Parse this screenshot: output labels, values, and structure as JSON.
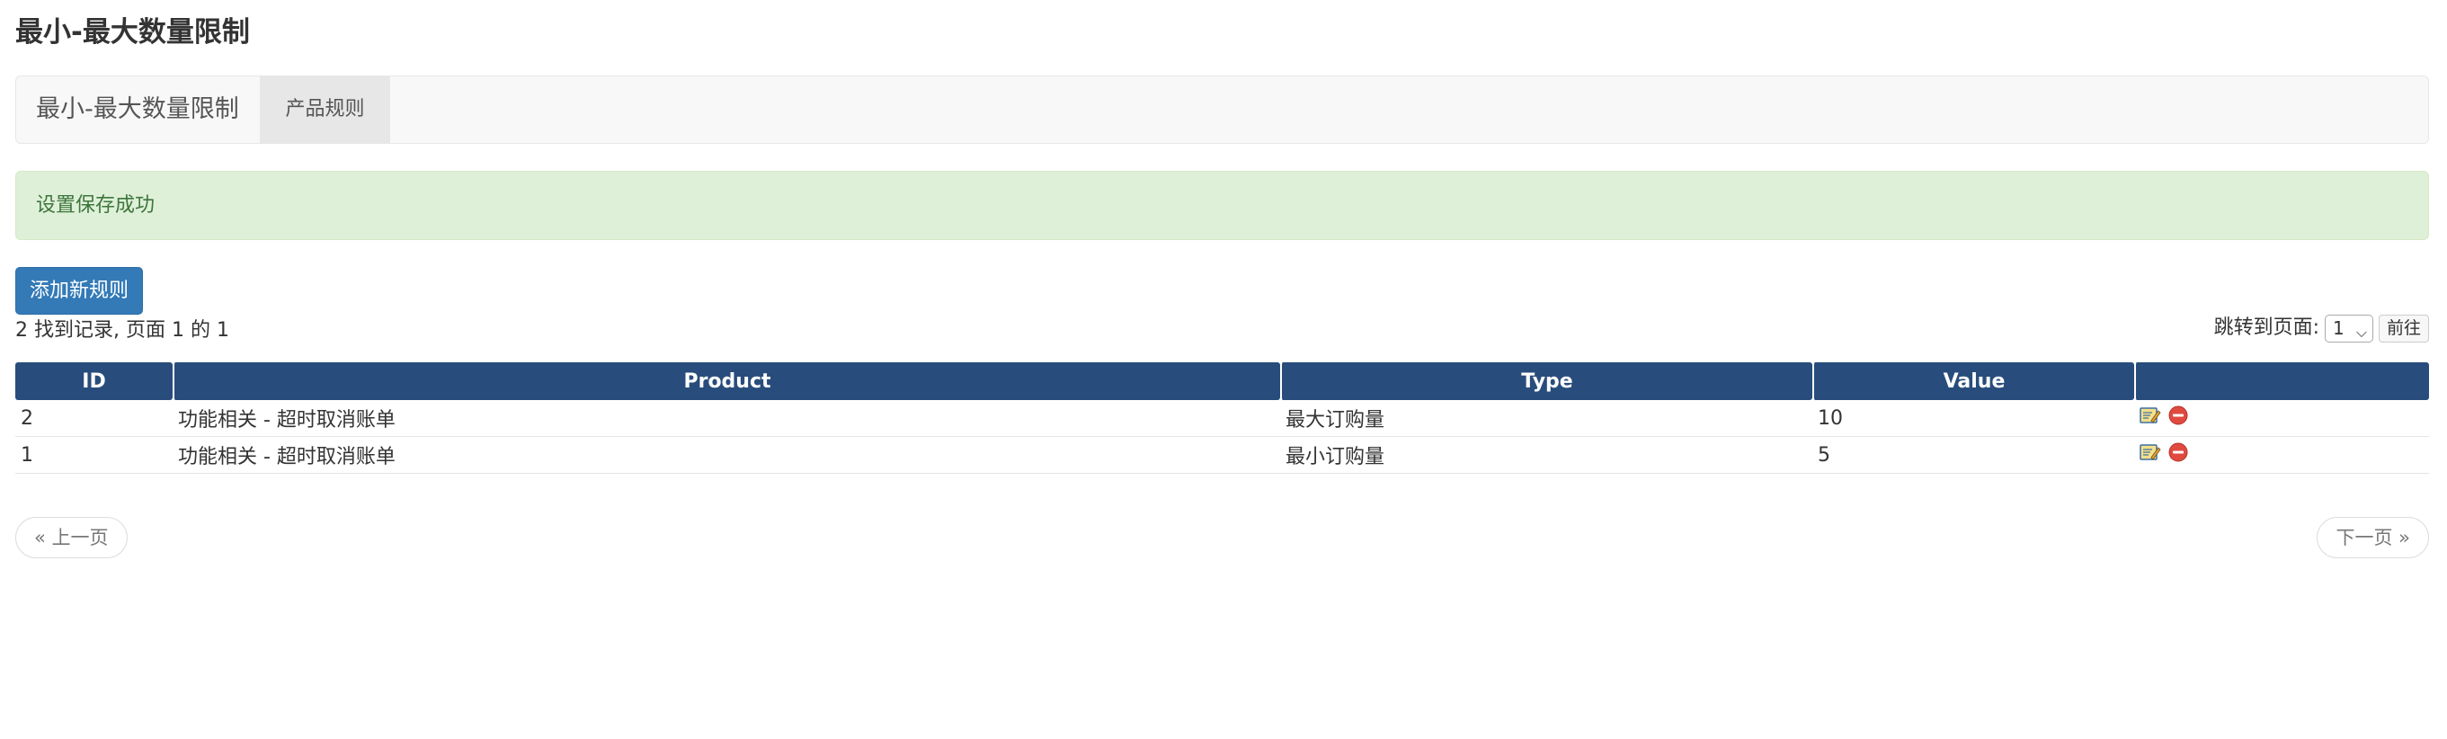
{
  "page": {
    "title": "最小-最大数量限制"
  },
  "navbar": {
    "brand": "最小-最大数量限制",
    "tab_label": "产品规则"
  },
  "alert": {
    "message": "设置保存成功"
  },
  "actions": {
    "add_rule": "添加新规则"
  },
  "records": {
    "summary": "2 找到记录, 页面 1 的 1"
  },
  "jump": {
    "label": "跳转到页面:",
    "selected": "1",
    "go": "前往"
  },
  "table": {
    "headers": {
      "id": "ID",
      "product": "Product",
      "type": "Type",
      "value": "Value",
      "actions": ""
    },
    "rows": [
      {
        "id": "2",
        "product": "功能相关 - 超时取消账单",
        "type": "最大订购量",
        "value": "10"
      },
      {
        "id": "1",
        "product": "功能相关 - 超时取消账单",
        "type": "最小订购量",
        "value": "5"
      }
    ]
  },
  "pager": {
    "prev": "« 上一页",
    "next": "下一页 »"
  },
  "icons": {
    "edit": "edit-icon",
    "delete": "delete-icon"
  },
  "colors": {
    "header": "#284d7c",
    "alert_bg": "#dff0d8",
    "alert_text": "#3c763d",
    "primary": "#337ab7"
  }
}
